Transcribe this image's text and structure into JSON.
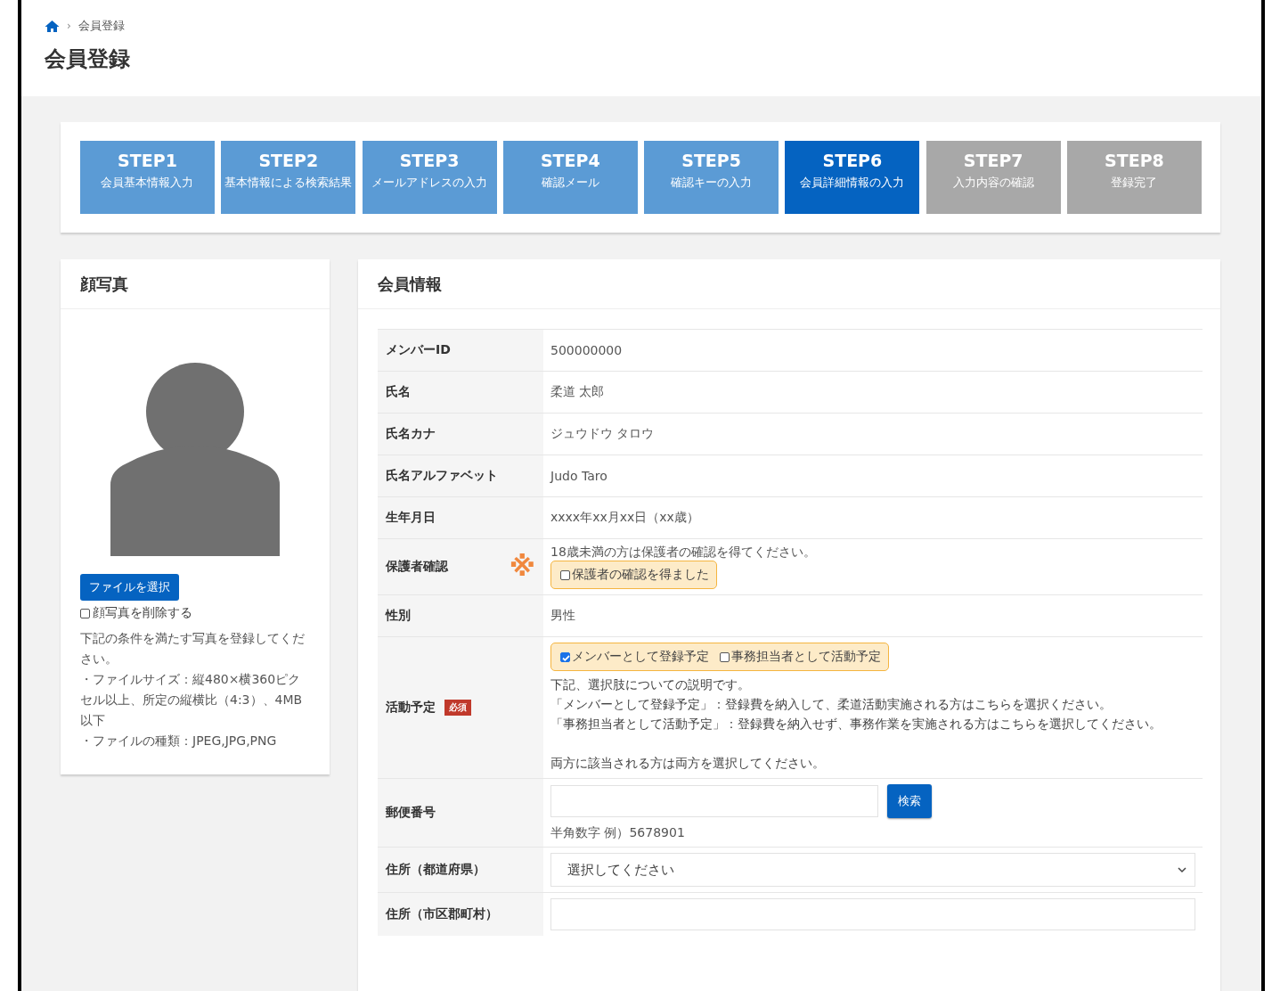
{
  "breadcrumb": {
    "separator": "›",
    "current": "会員登録"
  },
  "page_title": "会員登録",
  "steps": [
    {
      "label": "STEP1",
      "caption": "会員基本情報入力",
      "selected": false,
      "disabled": false
    },
    {
      "label": "STEP2",
      "caption": "基本情報による検索結果",
      "selected": false,
      "disabled": false
    },
    {
      "label": "STEP3",
      "caption": "メールアドレスの入力",
      "selected": false,
      "disabled": false
    },
    {
      "label": "STEP4",
      "caption": "確認メール",
      "selected": false,
      "disabled": false
    },
    {
      "label": "STEP5",
      "caption": "確認キーの入力",
      "selected": false,
      "disabled": false
    },
    {
      "label": "STEP6",
      "caption": "会員詳細情報の入力",
      "selected": true,
      "disabled": false
    },
    {
      "label": "STEP7",
      "caption": "入力内容の確認",
      "selected": false,
      "disabled": true
    },
    {
      "label": "STEP8",
      "caption": "登録完了",
      "selected": false,
      "disabled": true
    }
  ],
  "photo_panel": {
    "title": "顔写真",
    "button": "ファイルを選択",
    "delete_checkbox": {
      "label": "顔写真を削除する",
      "checked": false
    },
    "notes": [
      "下記の条件を満たす写真を登録してください。",
      "・ファイルサイズ：縦480×横360ピクセル以上、所定の縦横比（4:3）、4MB 以下",
      "・ファイルの種類：JPEG,JPG,PNG"
    ]
  },
  "member_panel": {
    "title": "会員情報",
    "rows": [
      {
        "kind": "text",
        "label": "メンバーID",
        "value": "500000000"
      },
      {
        "kind": "text",
        "label": "氏名",
        "value": "柔道 太郎"
      },
      {
        "kind": "text",
        "label": "氏名カナ",
        "value": "ジュウドウ タロウ"
      },
      {
        "kind": "text",
        "label": "氏名アルファベット",
        "value": "Judo Taro"
      },
      {
        "kind": "text",
        "label": "生年月日",
        "value": "xxxx年xx月xx日（xx歳）"
      },
      {
        "kind": "checks",
        "label": "保護者確認",
        "mark": "※",
        "note": "18歳未満の方は保護者の確認を得てください。",
        "options": [
          {
            "label": "保護者の確認を得ました",
            "checked": false
          }
        ]
      },
      {
        "kind": "text",
        "label": "性別",
        "value": "男性"
      },
      {
        "kind": "checks",
        "label": "活動予定",
        "badge": "必須",
        "options": [
          {
            "label": "メンバーとして登録予定",
            "checked": true
          },
          {
            "label": "事務担当者として活動予定",
            "checked": false
          }
        ],
        "description": [
          "下記、選択肢についての説明です。",
          "「メンバーとして登録予定」：登録費を納入して、柔道活動実施される方はこちらを選択ください。",
          "「事務担当者として活動予定」：登録費を納入せず、事務作業を実施される方はこちらを選択してください。",
          "両方に該当される方は両方を選択してください。"
        ]
      },
      {
        "kind": "postal",
        "label": "郵便番号",
        "button": "検索",
        "hint": "半角数字 例）5678901"
      },
      {
        "kind": "select",
        "label": "住所（都道府県）",
        "value": "選択してください"
      },
      {
        "kind": "input",
        "label": "住所（市区郡町村）"
      }
    ]
  }
}
